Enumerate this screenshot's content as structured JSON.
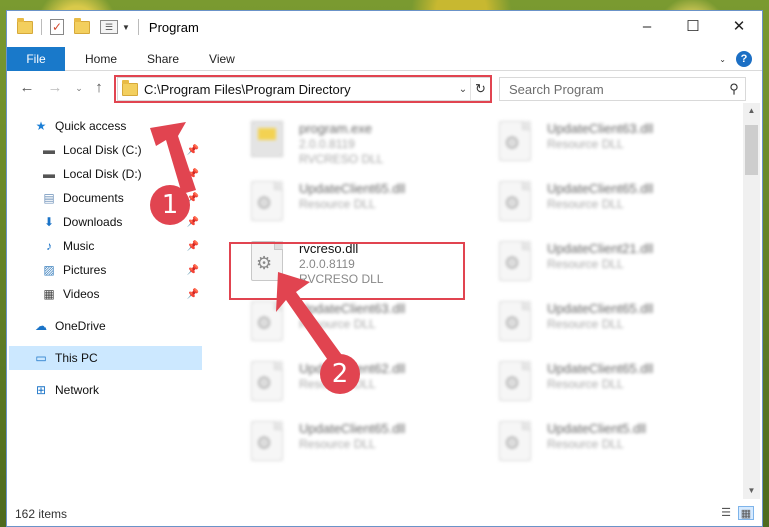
{
  "window": {
    "title": "Program",
    "controls": {
      "minimize": "–",
      "maximize": "☐",
      "close": "✕"
    }
  },
  "ribbon": {
    "tabs": [
      "File",
      "Home",
      "Share",
      "View"
    ],
    "help": "?"
  },
  "address": {
    "path": "C:\\Program Files\\Program Directory",
    "search_placeholder": "Search Program"
  },
  "sidebar": {
    "quick_access": "Quick access",
    "items": [
      {
        "label": "Local Disk (C:)",
        "icon": "drive-icon",
        "pinned": true
      },
      {
        "label": "Local Disk (D:)",
        "icon": "drive-icon",
        "pinned": true
      },
      {
        "label": "Documents",
        "icon": "documents-icon",
        "pinned": true
      },
      {
        "label": "Downloads",
        "icon": "downloads-icon",
        "pinned": true
      },
      {
        "label": "Music",
        "icon": "music-icon",
        "pinned": true
      },
      {
        "label": "Pictures",
        "icon": "pictures-icon",
        "pinned": true
      },
      {
        "label": "Videos",
        "icon": "videos-icon",
        "pinned": true
      }
    ],
    "onedrive": "OneDrive",
    "this_pc": "This PC",
    "network": "Network"
  },
  "files": [
    {
      "name": "program.exe",
      "version": "2.0.0.8119",
      "desc": "RVCRESO DLL",
      "kind": "exe",
      "blurred": true
    },
    {
      "name": "UpdateClient63.dll",
      "version": "",
      "desc": "Resource DLL",
      "kind": "dll",
      "blurred": true
    },
    {
      "name": "UpdateClient65.dll",
      "version": "",
      "desc": "Resource DLL",
      "kind": "dll",
      "blurred": true
    },
    {
      "name": "UpdateClient65.dll",
      "version": "",
      "desc": "Resource DLL",
      "kind": "dll",
      "blurred": true
    },
    {
      "name": "rvcreso.dll",
      "version": "2.0.0.8119",
      "desc": "RVCRESO DLL",
      "kind": "dll",
      "blurred": false
    },
    {
      "name": "UpdateClient21.dll",
      "version": "",
      "desc": "Resource DLL",
      "kind": "dll",
      "blurred": true
    },
    {
      "name": "UpdateClient63.dll",
      "version": "",
      "desc": "Resource DLL",
      "kind": "dll",
      "blurred": true
    },
    {
      "name": "UpdateClient65.dll",
      "version": "",
      "desc": "Resource DLL",
      "kind": "dll",
      "blurred": true
    },
    {
      "name": "UpdateClient62.dll",
      "version": "",
      "desc": "Resource DLL",
      "kind": "dll",
      "blurred": true
    },
    {
      "name": "UpdateClient65.dll",
      "version": "",
      "desc": "Resource DLL",
      "kind": "dll",
      "blurred": true
    },
    {
      "name": "UpdateClient65.dll",
      "version": "",
      "desc": "Resource DLL",
      "kind": "dll",
      "blurred": true
    },
    {
      "name": "UpdateClient5.dll",
      "version": "",
      "desc": "Resource DLL",
      "kind": "dll",
      "blurred": true
    }
  ],
  "status": {
    "count": "162 items"
  },
  "annotations": {
    "badge1": "1",
    "badge2": "2",
    "color": "#e14450"
  }
}
